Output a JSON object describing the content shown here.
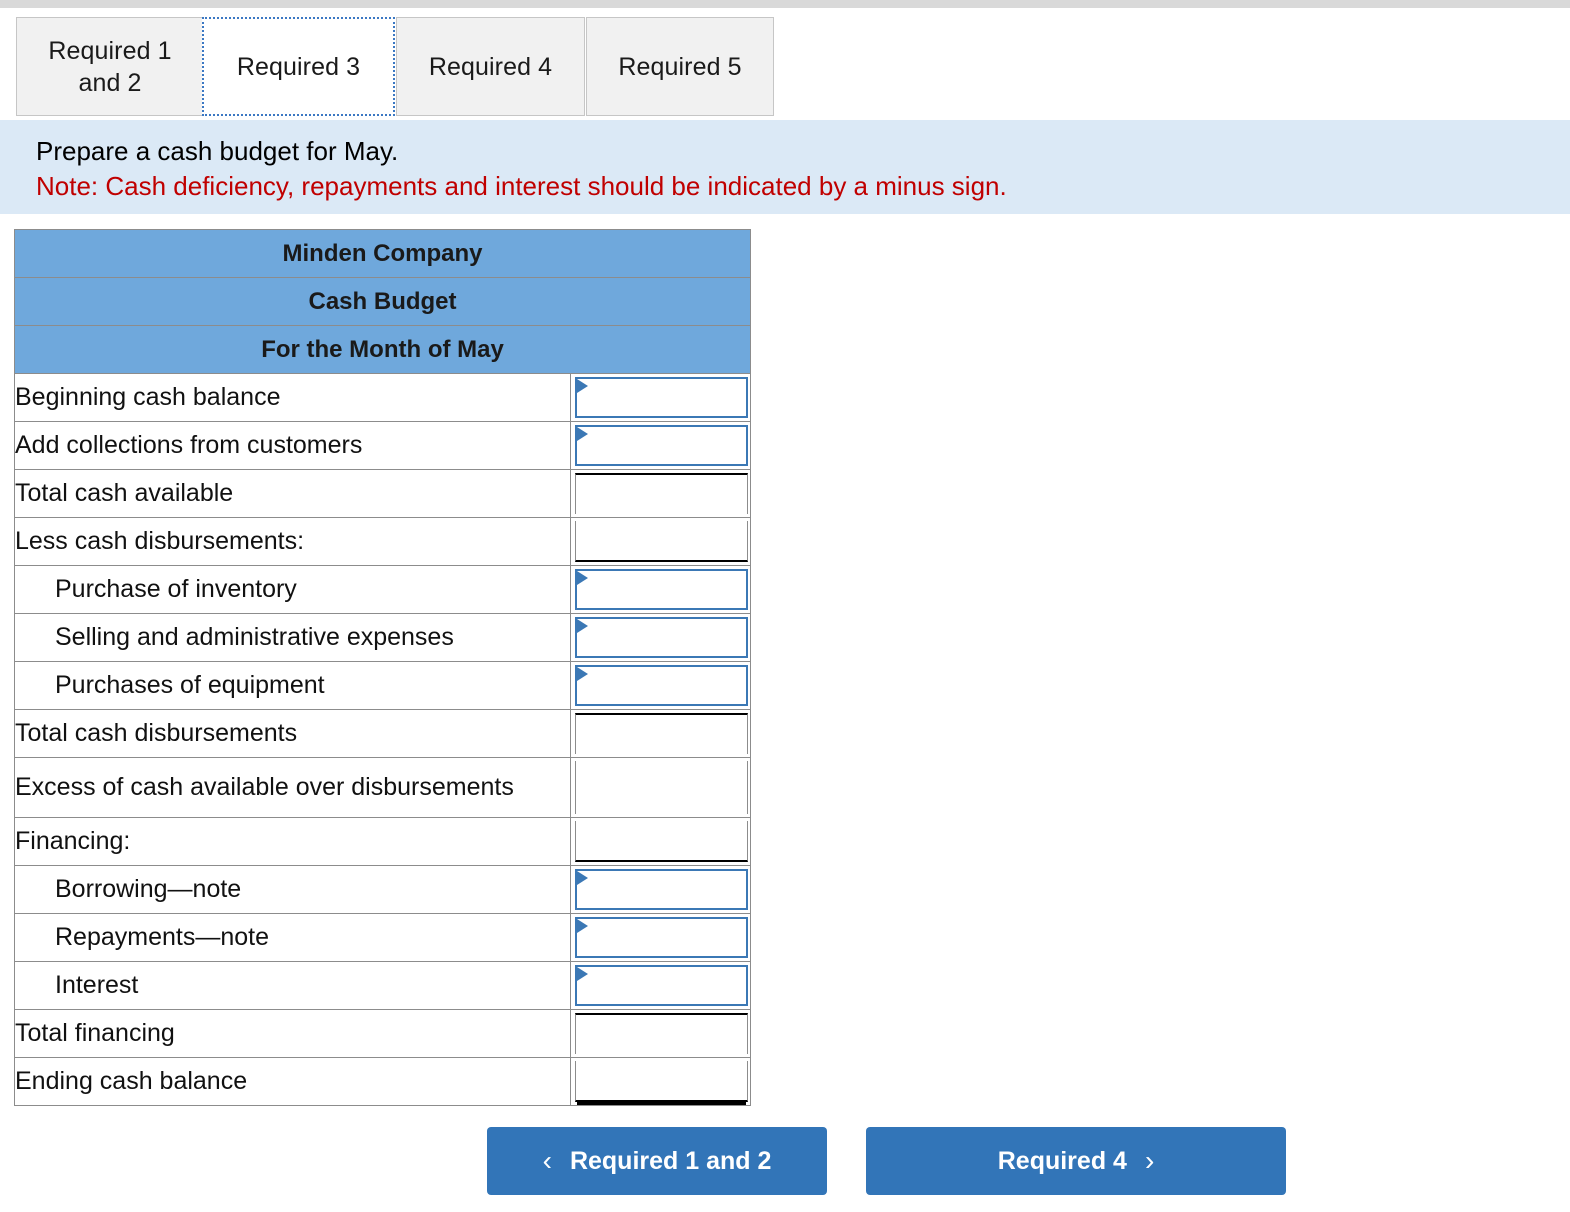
{
  "tabs": [
    {
      "label": "Required 1\nand 2",
      "active": false
    },
    {
      "label": "Required 3",
      "active": true
    },
    {
      "label": "Required 4",
      "active": false
    },
    {
      "label": "Required 5",
      "active": false
    }
  ],
  "instruction": {
    "prompt": "Prepare a cash budget for May.",
    "note": "Note: Cash deficiency, repayments and interest should be indicated by a minus sign."
  },
  "table": {
    "header_lines": [
      "Minden Company",
      "Cash Budget",
      "For the Month of May"
    ],
    "rows": [
      {
        "label": "Beginning cash balance",
        "indent": false,
        "kind": "input",
        "value": "",
        "tall": false
      },
      {
        "label": "Add collections from customers",
        "indent": false,
        "kind": "input",
        "value": "",
        "tall": false
      },
      {
        "label": "Total cash available",
        "indent": false,
        "kind": "calc",
        "value": "",
        "tall": false
      },
      {
        "label": "Less cash disbursements:",
        "indent": false,
        "kind": "calc",
        "value": "",
        "tall": false
      },
      {
        "label": "Purchase of inventory",
        "indent": true,
        "kind": "input",
        "value": "",
        "tall": false
      },
      {
        "label": "Selling and administrative expenses",
        "indent": true,
        "kind": "input",
        "value": "",
        "tall": false
      },
      {
        "label": "Purchases of equipment",
        "indent": true,
        "kind": "input",
        "value": "",
        "tall": false
      },
      {
        "label": "Total cash disbursements",
        "indent": false,
        "kind": "calc",
        "value": "",
        "tall": false
      },
      {
        "label": "Excess of cash available over disbursements",
        "indent": false,
        "kind": "calc",
        "value": "",
        "tall": true
      },
      {
        "label": "Financing:",
        "indent": false,
        "kind": "calc",
        "value": "",
        "tall": false
      },
      {
        "label": "Borrowing—note",
        "indent": true,
        "kind": "input",
        "value": "",
        "tall": false
      },
      {
        "label": "Repayments—note",
        "indent": true,
        "kind": "input",
        "value": "",
        "tall": false
      },
      {
        "label": "Interest",
        "indent": true,
        "kind": "input",
        "value": "",
        "tall": false
      },
      {
        "label": "Total financing",
        "indent": false,
        "kind": "calc",
        "value": "",
        "tall": false
      },
      {
        "label": "Ending cash balance",
        "indent": false,
        "kind": "calc",
        "value": "",
        "tall": false
      }
    ]
  },
  "nav": {
    "prev_label": "Required 1 and 2",
    "prev_icon": "chevron-left-icon",
    "next_label": "Required 4",
    "next_icon": "chevron-right-icon"
  },
  "colors": {
    "header_blue": "#6fa8dc",
    "banner_blue": "#dbe9f6",
    "button_blue": "#3275b8",
    "note_red": "#c00000",
    "input_border": "#3b78b5",
    "tab_gray": "#f1f1f1",
    "grid_gray": "#8c8c8c"
  }
}
